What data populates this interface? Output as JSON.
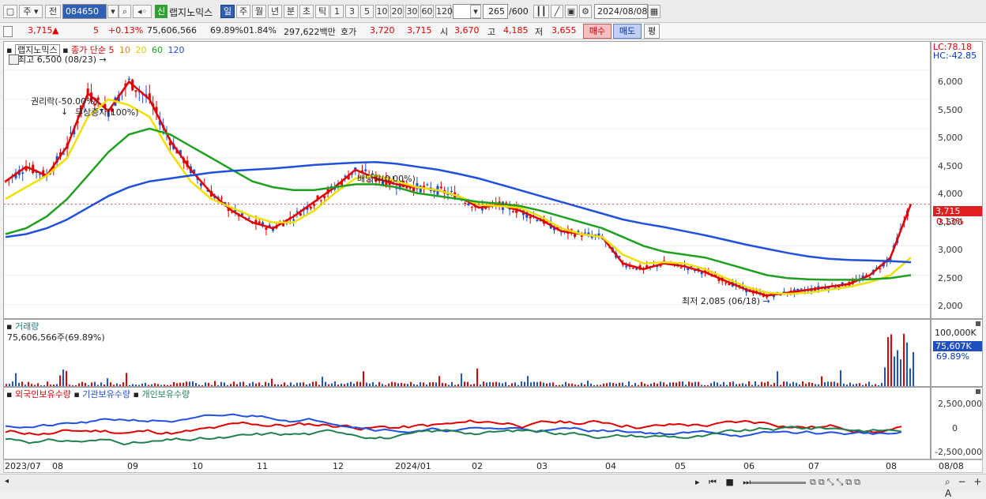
{
  "toolbar": {
    "window_icon": "window-icon",
    "market_type": "주",
    "market_type2": "전",
    "stock_code": "084650",
    "badge_new": "신",
    "stock_name": "랩지노믹스",
    "periods": [
      "일",
      "주",
      "월",
      "년",
      "분",
      "초",
      "틱"
    ],
    "selected_period": "일",
    "intervals": [
      "1",
      "3",
      "5",
      "10",
      "20",
      "30",
      "60",
      "120"
    ],
    "count_value": "265",
    "count_max": "/600",
    "date": "2024/08/08"
  },
  "quote": {
    "price": "3,715",
    "arrow": "▲",
    "change": "5",
    "change_rate": "+0.13%",
    "volume": "75,606,566",
    "vol_ratio": "69.89%",
    "turnover": "01.84%",
    "amount": "297,622백만",
    "bid_label": "호가",
    "ask_price": "3,720",
    "bid_price": "3,715",
    "open_label": "시",
    "open": "3,670",
    "high_label": "고",
    "high": "4,185",
    "low_label": "저",
    "low": "3,655",
    "buy_label": "매수",
    "sell_label": "매도",
    "eval_label": "평"
  },
  "price_pane": {
    "legend_name": "랩지노믹스",
    "legend_ma": "종가 단순",
    "ma_labels": [
      "5",
      "10",
      "20",
      "60",
      "120"
    ],
    "ma_colors": [
      "#e00000",
      "#f08000",
      "#f0e000",
      "#20a020",
      "#2050e0"
    ],
    "lc": "LC:78.18",
    "hc": "HC:-42.85",
    "y_ticks": [
      "6,000",
      "5,500",
      "5,000",
      "4,500",
      "4,000",
      "3,500",
      "3,000",
      "2,500",
      "2,000"
    ],
    "price_tag": "3,715",
    "price_pct": "0.13%",
    "high_note": "최고 6,500 (08/23)",
    "low_note": "최저 2,085 (06/18)",
    "ann_rights": "권리락(-50.00%)",
    "ann_bonus": "무상증자(100%)",
    "ann_dividend": "배당락(0.00%)"
  },
  "volume_pane": {
    "title": "거래량",
    "value": "75,606,566주(69.89%)",
    "y_top": "100,000K",
    "tag": "75,607K",
    "tag_pct": "69.89%"
  },
  "holding_pane": {
    "legends": [
      "외국인보유수량",
      "기관보유수량",
      "개인보유수량"
    ],
    "legend_colors": [
      "#e00000",
      "#2050e0",
      "#208050"
    ],
    "y_ticks": [
      "2,500,000",
      "0",
      "-2,500,000"
    ]
  },
  "x_axis": [
    "2023/07",
    "08",
    "09",
    "10",
    "11",
    "12",
    "2024/01",
    "02",
    "03",
    "04",
    "05",
    "06",
    "07",
    "08"
  ],
  "x_axis_right": "08/08",
  "chart_data": {
    "type": "line",
    "title": "",
    "ylim": [
      1900,
      6500
    ],
    "x_range": [
      "2023/07",
      "2024/08/08"
    ],
    "series": [
      {
        "name": "종가",
        "values": [
          4100,
          4350,
          4200,
          4700,
          5600,
          5300,
          5800,
          5500,
          4800,
          4300,
          3900,
          3600,
          3400,
          3300,
          3500,
          3750,
          4000,
          4300,
          4150,
          4050,
          4000,
          3950,
          3850,
          3650,
          3700,
          3600,
          3450,
          3250,
          3200,
          3150,
          2700,
          2600,
          2700,
          2650,
          2550,
          2400,
          2250,
          2150,
          2200,
          2250,
          2300,
          2350,
          2500,
          2800,
          3715
        ]
      },
      {
        "name": "20",
        "values": [
          3800,
          4000,
          4200,
          4500,
          5200,
          5500,
          5400,
          5200,
          4600,
          4100,
          3800,
          3650,
          3500,
          3400,
          3400,
          3600,
          3900,
          4150,
          4200,
          4100,
          4000,
          3950,
          3850,
          3700,
          3680,
          3650,
          3500,
          3300,
          3200,
          3150,
          2850,
          2700,
          2720,
          2700,
          2600,
          2450,
          2300,
          2200,
          2180,
          2200,
          2250,
          2300,
          2380,
          2500,
          2800
        ]
      },
      {
        "name": "60",
        "values": [
          3200,
          3300,
          3500,
          3800,
          4200,
          4600,
          4900,
          5000,
          4900,
          4700,
          4500,
          4300,
          4100,
          4000,
          3950,
          3950,
          4000,
          4050,
          4050,
          4000,
          3900,
          3850,
          3800,
          3750,
          3720,
          3680,
          3600,
          3500,
          3400,
          3300,
          3150,
          3000,
          2900,
          2850,
          2800,
          2700,
          2600,
          2500,
          2450,
          2430,
          2420,
          2420,
          2430,
          2450,
          2500
        ]
      },
      {
        "name": "120",
        "values": [
          3150,
          3200,
          3300,
          3450,
          3650,
          3850,
          4000,
          4100,
          4150,
          4200,
          4250,
          4280,
          4300,
          4320,
          4350,
          4380,
          4400,
          4420,
          4430,
          4400,
          4350,
          4300,
          4230,
          4150,
          4050,
          3950,
          3850,
          3750,
          3650,
          3550,
          3450,
          3380,
          3320,
          3250,
          3180,
          3100,
          3020,
          2950,
          2880,
          2820,
          2780,
          2760,
          2750,
          2740,
          2720
        ]
      }
    ]
  }
}
